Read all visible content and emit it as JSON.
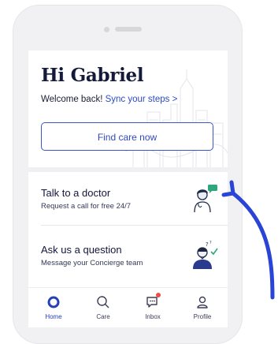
{
  "greeting": "Hi Gabriel",
  "welcome": {
    "text": "Welcome back! ",
    "link_text": "Sync your steps >"
  },
  "find_care_label": "Find care now",
  "items": [
    {
      "title": "Talk to a doctor",
      "subtitle": "Request a call for free 24/7",
      "icon": "doctor-chat-icon"
    },
    {
      "title": "Ask us a question",
      "subtitle": "Message your Concierge team",
      "icon": "concierge-check-icon"
    }
  ],
  "tabs": [
    {
      "label": "Home",
      "icon": "home-icon",
      "active": true
    },
    {
      "label": "Care",
      "icon": "search-icon",
      "active": false
    },
    {
      "label": "Inbox",
      "icon": "inbox-icon",
      "active": false,
      "badge": true
    },
    {
      "label": "Profile",
      "icon": "profile-icon",
      "active": false
    }
  ],
  "colors": {
    "accent": "#2b4ac7",
    "heading": "#141a3a",
    "badge": "#ef4b4b",
    "annotation_arrow": "#2a44d6",
    "phone_frame": "#f1f1f3"
  }
}
